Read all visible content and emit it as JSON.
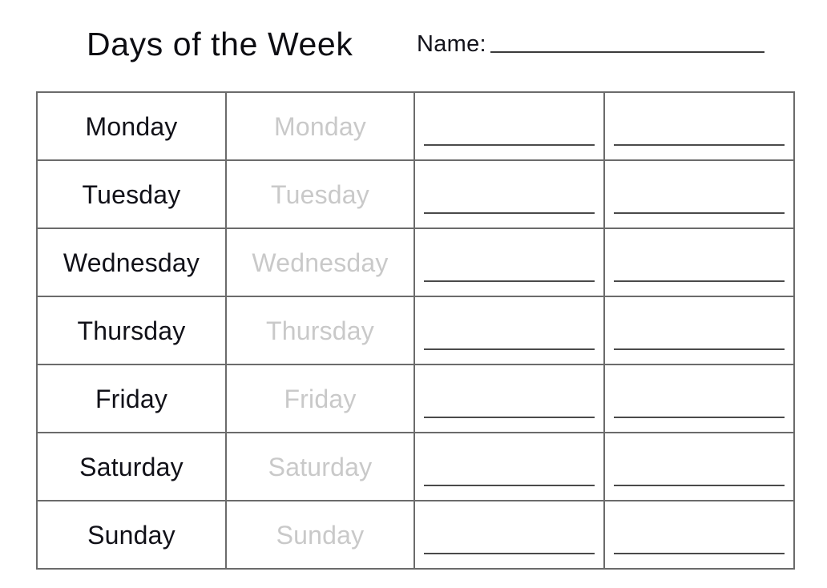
{
  "header": {
    "title": "Days of the Week",
    "name_label": "Name:",
    "name_value": "",
    "name_placeholder": ""
  },
  "table": {
    "columns": [
      {
        "key": "day_dark",
        "role": "printed-day-name"
      },
      {
        "key": "day_trace",
        "role": "traceable-day-name"
      },
      {
        "key": "write_line_1",
        "role": "handwriting-line"
      },
      {
        "key": "write_line_2",
        "role": "handwriting-line"
      }
    ],
    "rows": [
      {
        "day": "Monday",
        "trace": "Monday",
        "line_1": "",
        "line_2": ""
      },
      {
        "day": "Tuesday",
        "trace": "Tuesday",
        "line_1": "",
        "line_2": ""
      },
      {
        "day": "Wednesday",
        "trace": "Wednesday",
        "line_1": "",
        "line_2": ""
      },
      {
        "day": "Thursday",
        "trace": "Thursday",
        "line_1": "",
        "line_2": ""
      },
      {
        "day": "Friday",
        "trace": "Friday",
        "line_1": "",
        "line_2": ""
      },
      {
        "day": "Saturday",
        "trace": "Saturday",
        "line_1": "",
        "line_2": ""
      },
      {
        "day": "Sunday",
        "trace": "Sunday",
        "line_1": "",
        "line_2": ""
      }
    ]
  },
  "colors": {
    "page_background": "#ffffff",
    "text_dark": "#111118",
    "text_trace_gray": "#c9c9c9",
    "table_border": "#6b6b6b",
    "writing_line": "#4a4a4a",
    "name_line": "#3b3b3b"
  }
}
